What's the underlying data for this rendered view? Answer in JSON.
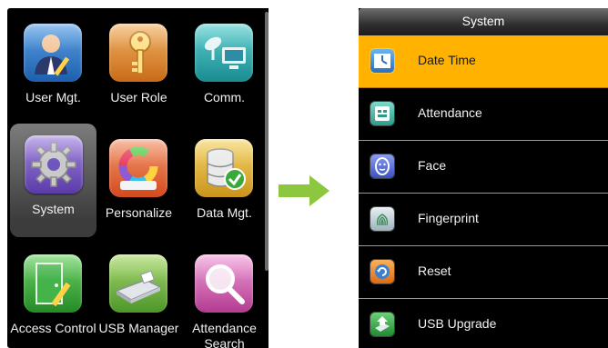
{
  "main_menu": {
    "tiles": [
      {
        "label": "User Mgt.",
        "icon": "user-icon"
      },
      {
        "label": "User Role",
        "icon": "key-icon"
      },
      {
        "label": "Comm.",
        "icon": "network-icon"
      },
      {
        "label": "System",
        "icon": "gear-icon",
        "selected": true
      },
      {
        "label": "Personalize",
        "icon": "color-wheel-icon"
      },
      {
        "label": "Data Mgt.",
        "icon": "database-icon"
      },
      {
        "label": "Access Control",
        "icon": "door-icon"
      },
      {
        "label": "USB Manager",
        "icon": "usb-drive-icon"
      },
      {
        "label": "Attendance Search",
        "icon": "magnifier-icon"
      }
    ]
  },
  "system_menu": {
    "title": "System",
    "items": [
      {
        "label": "Date Time",
        "icon": "clock-icon",
        "active": true
      },
      {
        "label": "Attendance",
        "icon": "attendance-icon"
      },
      {
        "label": "Face",
        "icon": "face-icon"
      },
      {
        "label": "Fingerprint",
        "icon": "fingerprint-icon"
      },
      {
        "label": "Reset",
        "icon": "reset-icon"
      },
      {
        "label": "USB Upgrade",
        "icon": "usb-upgrade-icon"
      }
    ]
  },
  "colors": {
    "highlight": "#ffb300",
    "arrow": "#8dc63f"
  }
}
